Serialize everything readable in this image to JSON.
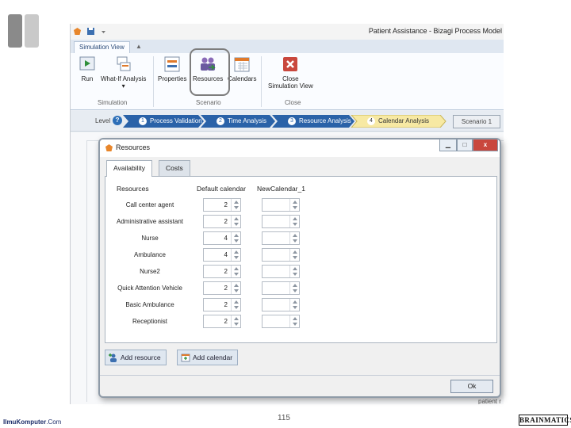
{
  "app": {
    "title": "Patient Assistance - Bizagi Process Model",
    "ribbon_tab": "Simulation View",
    "groups": {
      "simulation": "Simulation",
      "scenario": "Scenario",
      "close": "Close"
    },
    "buttons": {
      "run": "Run",
      "what_if": "What-If Analysis",
      "properties": "Properties",
      "resources": "Resources",
      "calendars": "Calendars",
      "close_line1": "Close",
      "close_line2": "Simulation View"
    },
    "level_label": "Level",
    "steps": [
      {
        "num": "1",
        "label": "Process Validation"
      },
      {
        "num": "2",
        "label": "Time Analysis"
      },
      {
        "num": "3",
        "label": "Resource Analysis"
      },
      {
        "num": "4",
        "label": "Calendar Analysis"
      }
    ],
    "scenario_button": "Scenario 1",
    "background_text": "patient r"
  },
  "dialog": {
    "title": "Resources",
    "tabs": [
      "Availability",
      "Costs"
    ],
    "columns": [
      "Resources",
      "Default calendar",
      "NewCalendar_1"
    ],
    "rows": [
      {
        "name": "Call center agent",
        "default": "2",
        "new": ""
      },
      {
        "name": "Administrative assistant",
        "default": "2",
        "new": ""
      },
      {
        "name": "Nurse",
        "default": "4",
        "new": ""
      },
      {
        "name": "Ambulance",
        "default": "4",
        "new": ""
      },
      {
        "name": "Nurse2",
        "default": "2",
        "new": ""
      },
      {
        "name": "Quick Attention Vehicle",
        "default": "2",
        "new": ""
      },
      {
        "name": "Basic Ambulance",
        "default": "2",
        "new": ""
      },
      {
        "name": "Receptionist",
        "default": "2",
        "new": ""
      }
    ],
    "add_resource": "Add resource",
    "add_calendar": "Add calendar",
    "ok": "Ok"
  },
  "footer": {
    "site_bold": "IlmuKomputer",
    "site_rest": ".Com",
    "page_number": "115",
    "brand": "BRAINMATICS"
  },
  "colors": {
    "step_blue": "#2a62a8",
    "step_active": "#f7e9a3",
    "close_red": "#c9473d"
  }
}
